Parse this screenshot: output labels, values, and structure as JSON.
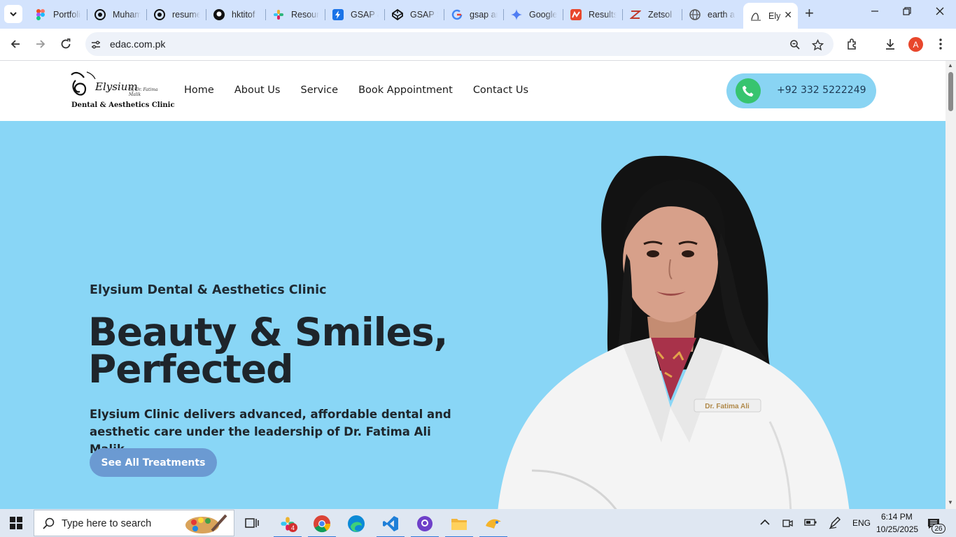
{
  "browser": {
    "tabs": [
      {
        "label": "Portfolio",
        "icon": "figma-icon"
      },
      {
        "label": "Muhammad",
        "icon": "openai-icon"
      },
      {
        "label": "resume",
        "icon": "openai-icon"
      },
      {
        "label": "hktitof",
        "icon": "github-icon"
      },
      {
        "label": "Resources",
        "icon": "slack-icon"
      },
      {
        "label": "GSAP &",
        "icon": "bolt-icon"
      },
      {
        "label": "GSAP S",
        "icon": "codepen-icon"
      },
      {
        "label": "gsap ar",
        "icon": "google-icon"
      },
      {
        "label": "Google",
        "icon": "gemini-icon"
      },
      {
        "label": "Results",
        "icon": "results-icon"
      },
      {
        "label": "Zetsol",
        "icon": "zetsol-icon"
      },
      {
        "label": "earth a",
        "icon": "globe-icon"
      },
      {
        "label": "Ely",
        "icon": "elysium-icon",
        "active": true
      }
    ],
    "url": "edac.com.pk",
    "profile_initial": "A"
  },
  "site": {
    "logo": {
      "line1": "Elysium",
      "line2": "By Dr. Fatima Malik",
      "line3": "Dental & Aesthetics Clinic"
    },
    "nav": [
      "Home",
      "About Us",
      "Service",
      "Book Appointment",
      "Contact Us"
    ],
    "phone": "+92 332 5222249",
    "hero": {
      "eyebrow": "Elysium Dental & Aesthetics Clinic",
      "title_line1": "Beauty & Smiles,",
      "title_line2": "Perfected",
      "description": "Elysium Clinic delivers advanced, affordable dental and aesthetic care under the leadership of Dr. Fatima Ali Malik.",
      "cta": "See All Treatments",
      "badge_text": "Dr. Fatima Ali"
    }
  },
  "taskbar": {
    "search_placeholder": "Type here to search",
    "language": "ENG",
    "time": "6:14 PM",
    "date": "10/25/2025",
    "notifications": "26",
    "slack_badge": "4"
  },
  "colors": {
    "hero_bg": "#89d6f6",
    "cta_bg": "#6b9ad2",
    "phone_green": "#37c46f",
    "tabstrip": "#d3e3fd"
  }
}
